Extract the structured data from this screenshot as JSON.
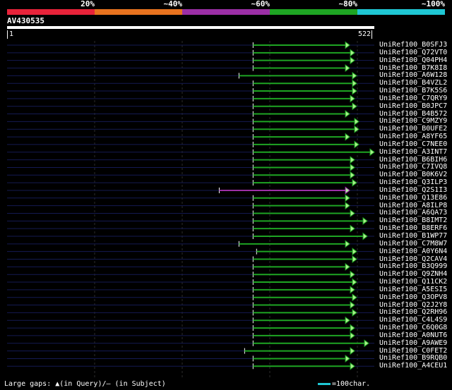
{
  "legend": {
    "labels": [
      "20%",
      "~40%",
      "~60%",
      "~80%",
      "~100%"
    ],
    "colors": [
      "#e8233a",
      "#e8731f",
      "#9c2fa6",
      "#1ea523",
      "#1fc7d4"
    ]
  },
  "query": {
    "id": "AV430535",
    "start": "1",
    "end": "522",
    "length": 522
  },
  "colors": {
    "background": "#000000",
    "track": "#141a52",
    "hit_green": "#1ea523",
    "hit_purple": "#9c2fa6",
    "grid": "#2c2c2c"
  },
  "hits": [
    {
      "name": "UniRef100_B0SFJ3",
      "start": 350,
      "end": 487,
      "color": "green",
      "lead": false
    },
    {
      "name": "UniRef100_Q72VT0",
      "start": 350,
      "end": 494,
      "color": "green",
      "lead": false
    },
    {
      "name": "UniRef100_Q04PH4",
      "start": 350,
      "end": 494,
      "color": "green",
      "lead": false
    },
    {
      "name": "UniRef100_B7K8I8",
      "start": 350,
      "end": 487,
      "color": "green",
      "lead": false
    },
    {
      "name": "UniRef100_A6W128",
      "start": 330,
      "end": 497,
      "color": "green",
      "lead": true
    },
    {
      "name": "UniRef100_B4VZL2",
      "start": 350,
      "end": 497,
      "color": "green",
      "lead": false
    },
    {
      "name": "UniRef100_B7K5S6",
      "start": 350,
      "end": 497,
      "color": "green",
      "lead": false
    },
    {
      "name": "UniRef100_C7QRY9",
      "start": 350,
      "end": 494,
      "color": "green",
      "lead": false
    },
    {
      "name": "UniRef100_B0JPC7",
      "start": 350,
      "end": 497,
      "color": "green",
      "lead": false
    },
    {
      "name": "UniRef100_B4B572",
      "start": 350,
      "end": 487,
      "color": "green",
      "lead": false
    },
    {
      "name": "UniRef100_C9MZY9",
      "start": 350,
      "end": 500,
      "color": "green",
      "lead": false
    },
    {
      "name": "UniRef100_B0UFE2",
      "start": 350,
      "end": 500,
      "color": "green",
      "lead": false
    },
    {
      "name": "UniRef100_A8YF65",
      "start": 350,
      "end": 487,
      "color": "green",
      "lead": false
    },
    {
      "name": "UniRef100_C7NEE0",
      "start": 350,
      "end": 500,
      "color": "green",
      "lead": false
    },
    {
      "name": "UniRef100_A3INT7",
      "start": 350,
      "end": 522,
      "color": "green",
      "lead": false
    },
    {
      "name": "UniRef100_B6BIH6",
      "start": 350,
      "end": 494,
      "color": "green",
      "lead": false
    },
    {
      "name": "UniRef100_C7IVQ8",
      "start": 350,
      "end": 494,
      "color": "green",
      "lead": false
    },
    {
      "name": "UniRef100_B0K6V2",
      "start": 350,
      "end": 494,
      "color": "green",
      "lead": false
    },
    {
      "name": "UniRef100_Q3ILP3",
      "start": 350,
      "end": 497,
      "color": "green",
      "lead": false
    },
    {
      "name": "UniRef100_Q2S1I3",
      "start": 302,
      "end": 487,
      "color": "purple",
      "lead": false
    },
    {
      "name": "UniRef100_Q13E86",
      "start": 350,
      "end": 487,
      "color": "green",
      "lead": false
    },
    {
      "name": "UniRef100_A8ILP8",
      "start": 350,
      "end": 487,
      "color": "green",
      "lead": false
    },
    {
      "name": "UniRef100_A6QA73",
      "start": 350,
      "end": 494,
      "color": "green",
      "lead": false
    },
    {
      "name": "UniRef100_B8IMT2",
      "start": 350,
      "end": 512,
      "color": "green",
      "lead": false
    },
    {
      "name": "UniRef100_B8ERF6",
      "start": 350,
      "end": 494,
      "color": "green",
      "lead": false
    },
    {
      "name": "UniRef100_B1WP77",
      "start": 350,
      "end": 512,
      "color": "green",
      "lead": false
    },
    {
      "name": "UniRef100_C7M8W7",
      "start": 330,
      "end": 487,
      "color": "green",
      "lead": false
    },
    {
      "name": "UniRef100_A0Y6N4",
      "start": 355,
      "end": 497,
      "color": "green",
      "lead": false
    },
    {
      "name": "UniRef100_Q2CAV4",
      "start": 350,
      "end": 497,
      "color": "green",
      "lead": false
    },
    {
      "name": "UniRef100_B3Q999",
      "start": 350,
      "end": 487,
      "color": "green",
      "lead": false
    },
    {
      "name": "UniRef100_Q9ZNH4",
      "start": 350,
      "end": 494,
      "color": "green",
      "lead": false
    },
    {
      "name": "UniRef100_Q11CK2",
      "start": 350,
      "end": 497,
      "color": "green",
      "lead": false
    },
    {
      "name": "UniRef100_A5ESI5",
      "start": 350,
      "end": 494,
      "color": "green",
      "lead": false
    },
    {
      "name": "UniRef100_Q3OPV8",
      "start": 350,
      "end": 497,
      "color": "green",
      "lead": false
    },
    {
      "name": "UniRef100_Q2J2Y8",
      "start": 350,
      "end": 494,
      "color": "green",
      "lead": false
    },
    {
      "name": "UniRef100_Q2RH96",
      "start": 350,
      "end": 497,
      "color": "green",
      "lead": false
    },
    {
      "name": "UniRef100_C4L4S9",
      "start": 350,
      "end": 487,
      "color": "green",
      "lead": false
    },
    {
      "name": "UniRef100_C6Q0G8",
      "start": 350,
      "end": 494,
      "color": "green",
      "lead": false
    },
    {
      "name": "UniRef100_A0NUT6",
      "start": 350,
      "end": 494,
      "color": "green",
      "lead": false
    },
    {
      "name": "UniRef100_A9AWE9",
      "start": 350,
      "end": 514,
      "color": "green",
      "lead": false
    },
    {
      "name": "UniRef100_C0FET2",
      "start": 338,
      "end": 494,
      "color": "green",
      "lead": false
    },
    {
      "name": "UniRef100_B9RQB0",
      "start": 350,
      "end": 487,
      "color": "green",
      "lead": false
    },
    {
      "name": "UniRef100_A4CEU1",
      "start": 350,
      "end": 494,
      "color": "green",
      "lead": false
    }
  ],
  "footer": {
    "note": "Large gaps: ▲(in Query)/– (in Subject)",
    "scale_key": "=100char."
  }
}
